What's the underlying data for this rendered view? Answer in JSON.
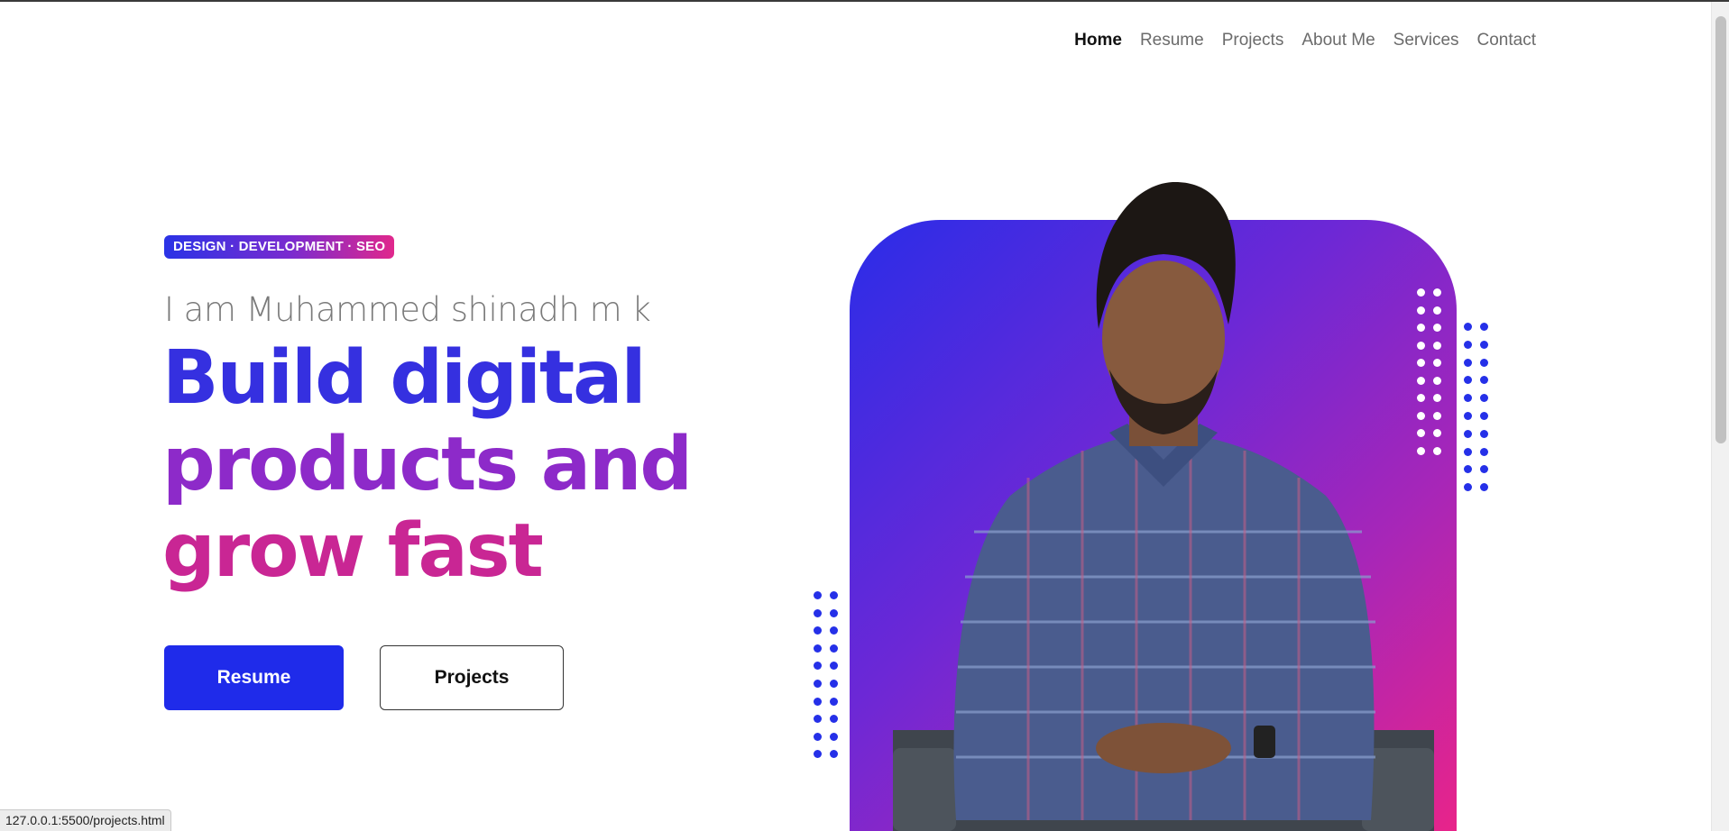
{
  "nav": {
    "items": [
      {
        "label": "Home",
        "active": true
      },
      {
        "label": "Resume",
        "active": false
      },
      {
        "label": "Projects",
        "active": false
      },
      {
        "label": "About Me",
        "active": false
      },
      {
        "label": "Services",
        "active": false
      },
      {
        "label": "Contact",
        "active": false
      }
    ]
  },
  "hero": {
    "badge": "DESIGN · DEVELOPMENT · SEO",
    "intro": "I am Muhammed shinadh m k",
    "headline": [
      "Build digital",
      "products and",
      "grow fast"
    ],
    "primary_button": "Resume",
    "secondary_button": "Projects"
  },
  "colors": {
    "accent_blue": "#1f2bea",
    "gradient_start": "#2a2de8",
    "gradient_end": "#e8248a",
    "dots_blue": "#2530e8",
    "dots_white": "#ffffff"
  },
  "status_bar": {
    "url": "127.0.0.1:5500/projects.html"
  }
}
